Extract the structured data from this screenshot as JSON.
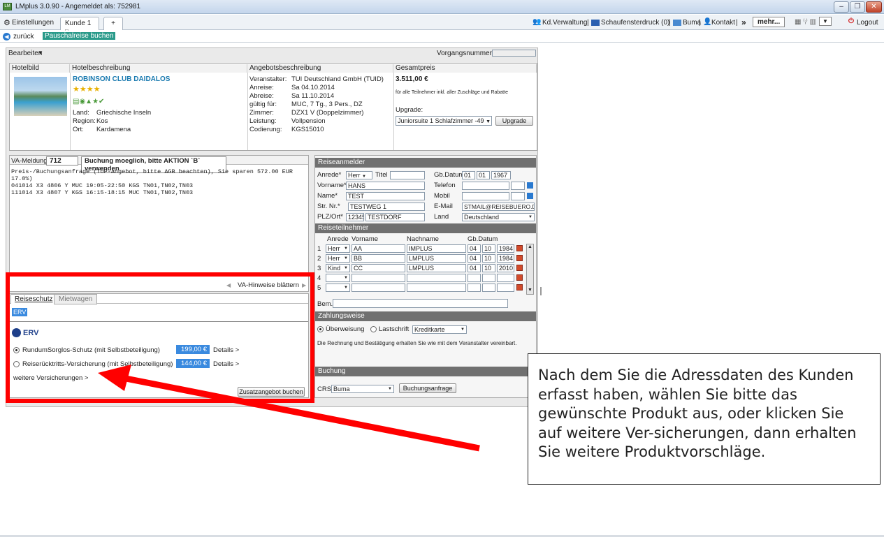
{
  "window": {
    "title": "LMplus 3.0.90 - Angemeldet als: 752981",
    "btn_min": "–",
    "btn_max": "❐",
    "btn_close": "✕"
  },
  "tabs": {
    "settings": "Einstellungen",
    "customer": "Kunde 1",
    "add": "+"
  },
  "topnav": {
    "kd": "Kd.Verwaltung",
    "sep": "|",
    "schaufenster": "Schaufensterdruck (0)",
    "buma": "Buma",
    "kontakt": "Kontakt",
    "more": "mehr...",
    "logout": "Logout",
    "chevron": "»",
    "dropdown": "▼"
  },
  "nav": {
    "back": "zurück",
    "booking": "Pauschalreise buchen"
  },
  "toolbar": {
    "bearbeiten": "Bearbeiten",
    "vorgang_label": "Vorgangsnummer:",
    "vorgang_value": ""
  },
  "offer": {
    "headers": {
      "hotelbild": "Hotelbild",
      "hotelbeschreibung": "Hotelbeschreibung",
      "angebot": "Angebotsbeschreibung",
      "gesamtpreis": "Gesamtpreis"
    },
    "hotel_name": "ROBINSON CLUB DAIDALOS",
    "stars": "★★★★",
    "land_label": "Land:",
    "land": "Griechische Inseln",
    "region_label": "Region:",
    "region": "Kos",
    "ort_label": "Ort:",
    "ort": "Kardamena",
    "veranstalter_label": "Veranstalter:",
    "veranstalter": "TUI Deutschland GmbH (TUID)",
    "anreise_label": "Anreise:",
    "anreise": "Sa 04.10.2014",
    "abreise_label": "Abreise:",
    "abreise": "Sa 11.10.2014",
    "gueltig_label": "gültig für:",
    "gueltig": "MUC, 7 Tg., 3 Pers., DZ",
    "zimmer_label": "Zimmer:",
    "zimmer": "DZX1 V (Doppelzimmer)",
    "leistung_label": "Leistung:",
    "leistung": "Vollpension",
    "codierung_label": "Codierung:",
    "codierung": "KGS15010",
    "price": "3.511,00 €",
    "price_note": "für alle Teilnehmer inkl. aller Zuschläge und Rabatte",
    "upgrade_label": "Upgrade:",
    "upgrade_value": "Juniorsuite 1 Schlafzimmer -49",
    "upgrade_btn": "Upgrade"
  },
  "va": {
    "label": "VA-Meldung:",
    "code": "712",
    "message": "Buchung moeglich, bitte AKTION `B` verwenden",
    "text": [
      "Preis-/Buchungsanfrage (TOP-Angebot, bitte AGB beachten), Sie sparen 572.00 EUR",
      "17.0%)",
      "041014 X3 4806 Y MUC 19:05-22:50 KGS TN01,TN02,TN03",
      "111014 X3 4807 Y KGS 16:15-18:15 MUC TN01,TN02,TN03"
    ],
    "paging": "VA-Hinweise blättern"
  },
  "insurance": {
    "tab_reiseschutz": "Reiseschutz",
    "tab_mietwagen": "Mietwagen",
    "erv_tag": "ERV",
    "erv_logo": "ERV",
    "options": [
      {
        "label": "RundumSorglos-Schutz (mit Selbstbeteiligung)",
        "price": "199,00 €",
        "details": "Details >",
        "selected": true
      },
      {
        "label": "Reiserücktritts-Versicherung (mit Selbstbeteiligung)",
        "price": "144,00 €",
        "details": "Details >",
        "selected": false
      }
    ],
    "more_link": "weitere Versicherungen >",
    "book_btn": "Zusatzangebot buchen"
  },
  "anmelder": {
    "title": "Reiseanmelder",
    "anrede_label": "Anrede*",
    "anrede": "Herr",
    "titel_label": "Titel",
    "titel": "",
    "gb_label": "Gb.Datum",
    "gb_d": "01",
    "gb_m": "01",
    "gb_y": "1967",
    "vorname_label": "Vorname*",
    "vorname": "HANS",
    "telefon_label": "Telefon",
    "name_label": "Name*",
    "name": "TEST",
    "mobil_label": "Mobil",
    "str_label": "Str. Nr.*",
    "str": "TESTWEG 1",
    "email_label": "E-Mail",
    "email": "STMAIL@REISEBUERO.DE",
    "plz_label": "PLZ/Ort*",
    "plz": "12345",
    "ort": "TESTDORF",
    "land_label": "Land",
    "land": "Deutschland"
  },
  "teilnehmer": {
    "title": "Reiseteilnehmer",
    "h_anrede": "Anrede",
    "h_vorname": "Vorname",
    "h_nachname": "Nachname",
    "h_gb": "Gb.Datum",
    "rows": [
      {
        "n": "1",
        "anrede": "Herr",
        "vorname": "AA",
        "nachname": "IMPLUS",
        "d": "04",
        "m": "10",
        "y": "1984"
      },
      {
        "n": "2",
        "anrede": "Herr",
        "vorname": "BB",
        "nachname": "LMPLUS",
        "d": "04",
        "m": "10",
        "y": "1984"
      },
      {
        "n": "3",
        "anrede": "Kind",
        "vorname": "CC",
        "nachname": "LMPLUS",
        "d": "04",
        "m": "10",
        "y": "2010"
      },
      {
        "n": "4",
        "anrede": "",
        "vorname": "",
        "nachname": "",
        "d": "",
        "m": "",
        "y": ""
      },
      {
        "n": "5",
        "anrede": "",
        "vorname": "",
        "nachname": "",
        "d": "",
        "m": "",
        "y": ""
      }
    ],
    "bem_label": "Bem."
  },
  "zahlung": {
    "title": "Zahlungsweise",
    "ueberweisung": "Überweisung",
    "lastschrift": "Lastschrift",
    "kreditkarte": "Kreditkarte",
    "note": "Die Rechnung und Bestätigung erhalten Sie wie mit dem Veranstalter vereinbart."
  },
  "buchung": {
    "title": "Buchung",
    "crs_label": "CRS:",
    "crs": "Buma",
    "anfrage_btn": "Buchungsanfrage"
  },
  "callout": {
    "text": "Nach dem Sie die Adressdaten des Kunden erfasst haben, wählen Sie bitte das gewünschte Produkt aus, oder klicken Sie auf weitere Ver-sicherungen, dann erhalten Sie weitere Produktvorschläge."
  },
  "colors": {
    "highlight": "#ff0000",
    "accent": "#3a8adf",
    "bar": "#707070"
  }
}
